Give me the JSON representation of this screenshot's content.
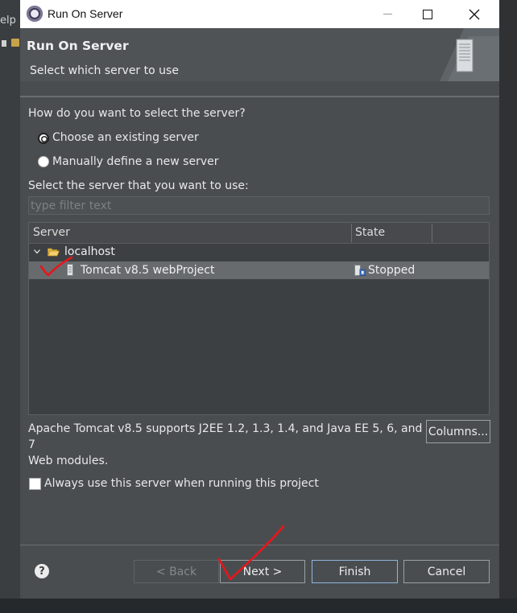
{
  "background": {
    "menu_fragment": "elp"
  },
  "window": {
    "title": "Run On Server"
  },
  "header": {
    "title": "Run On Server",
    "description": "Select which server to use"
  },
  "selection": {
    "question": "How do you want to select the server?",
    "options": [
      {
        "label": "Choose an existing server",
        "selected": true
      },
      {
        "label": "Manually define a new server",
        "selected": false
      }
    ]
  },
  "server_list": {
    "label": "Select the server that you want to use:",
    "filter_placeholder": "type filter text",
    "columns": [
      "Server",
      "State"
    ],
    "rows": [
      {
        "name": "localhost",
        "state": ""
      },
      {
        "name": "Tomcat v8.5 webProject",
        "state": "Stopped"
      }
    ],
    "description_line1": "Apache Tomcat v8.5 supports J2EE 1.2, 1.3, 1.4, and Java EE 5, 6, and 7",
    "description_line2": "Web modules.",
    "columns_button": "Columns..."
  },
  "options": {
    "always_use_label": "Always use this server when running this project"
  },
  "buttons": {
    "back": "< Back",
    "next": "Next >",
    "finish": "Finish",
    "cancel": "Cancel"
  },
  "colors": {
    "dialog_bg": "#4a4d50",
    "annotation": "#e8151b"
  }
}
